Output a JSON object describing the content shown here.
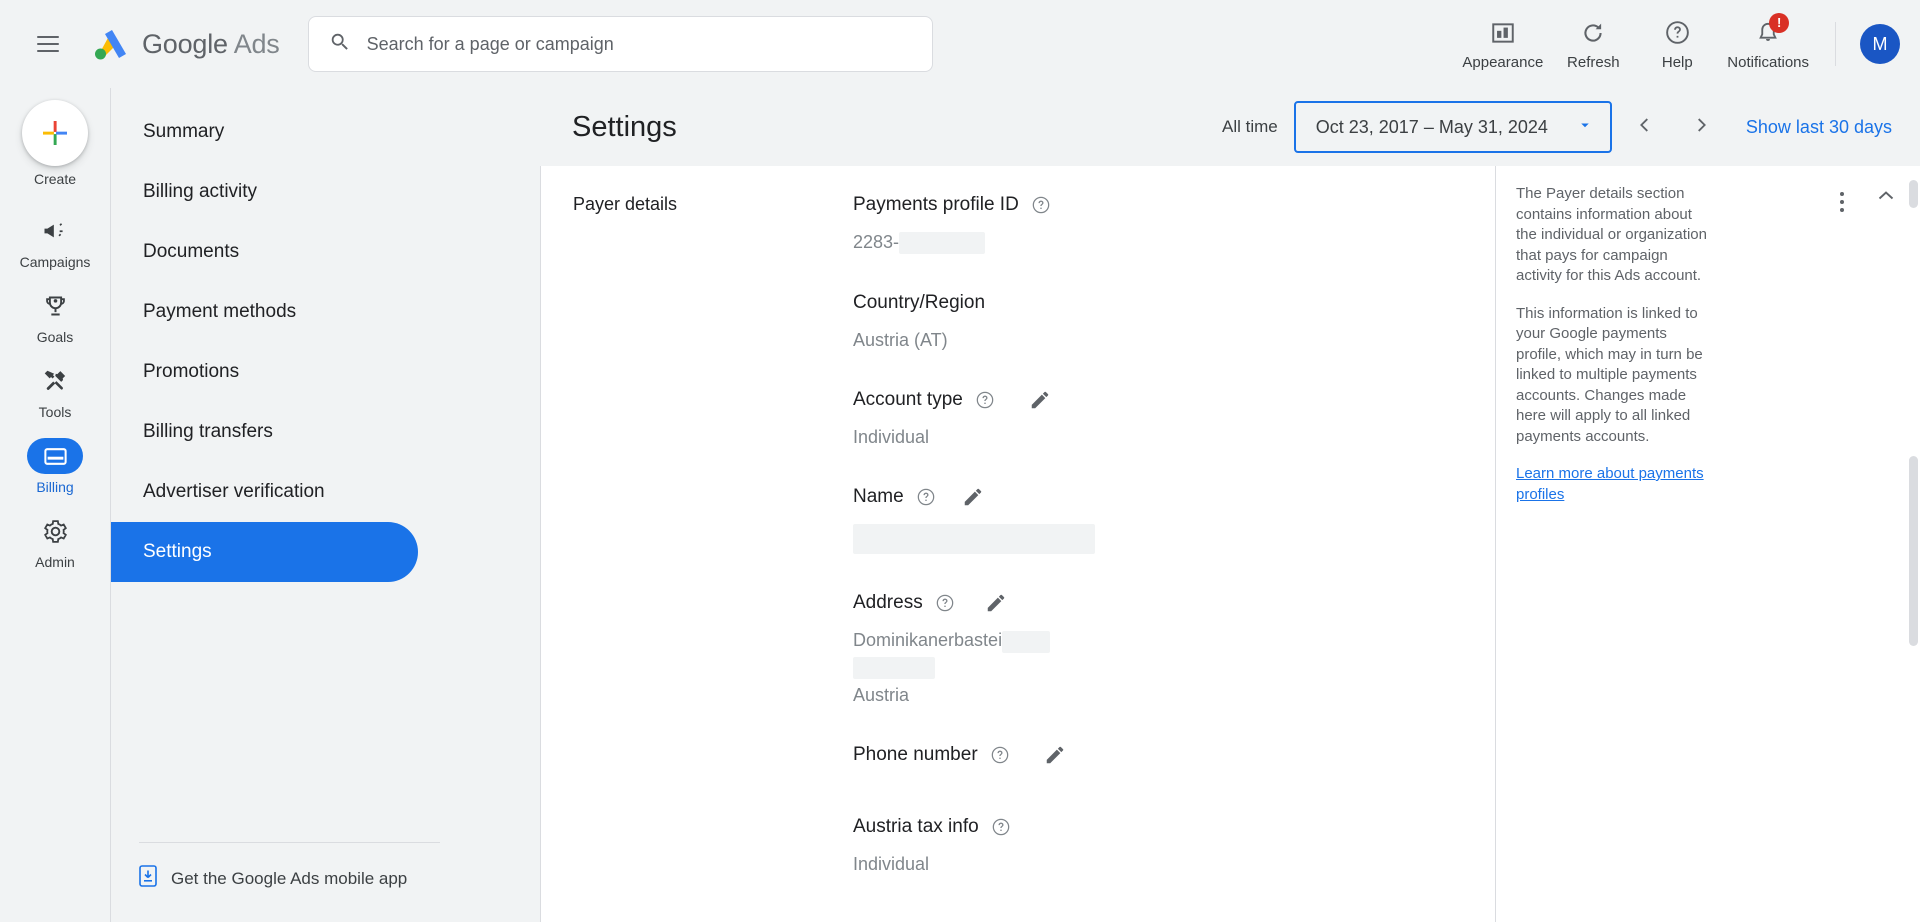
{
  "header": {
    "menu_icon": "hamburger-icon",
    "brand_google": "Google",
    "brand_ads": "Ads",
    "search": {
      "icon": "search-icon",
      "placeholder": "Search for a page or campaign",
      "value": ""
    },
    "tools": [
      {
        "icon": "appearance-icon",
        "label": "Appearance"
      },
      {
        "icon": "refresh-icon",
        "label": "Refresh"
      },
      {
        "icon": "help-icon",
        "label": "Help"
      },
      {
        "icon": "notifications-bell-icon",
        "label": "Notifications",
        "badge": "!"
      }
    ],
    "avatar_initial": "M"
  },
  "rail": {
    "items": [
      {
        "icon": "create-plus-icon",
        "label": "Create",
        "active": false
      },
      {
        "icon": "campaigns-megaphone-icon",
        "label": "Campaigns",
        "active": false
      },
      {
        "icon": "goals-trophy-icon",
        "label": "Goals",
        "active": false
      },
      {
        "icon": "tools-wrench-icon",
        "label": "Tools",
        "active": false
      },
      {
        "icon": "billing-card-icon",
        "label": "Billing",
        "active": true
      },
      {
        "icon": "admin-gear-icon",
        "label": "Admin",
        "active": false
      }
    ]
  },
  "subnav": {
    "items": [
      {
        "label": "Summary",
        "active": false
      },
      {
        "label": "Billing activity",
        "active": false
      },
      {
        "label": "Documents",
        "active": false
      },
      {
        "label": "Payment methods",
        "active": false
      },
      {
        "label": "Promotions",
        "active": false
      },
      {
        "label": "Billing transfers",
        "active": false
      },
      {
        "label": "Advertiser verification",
        "active": false
      },
      {
        "label": "Settings",
        "active": true
      }
    ],
    "footer": {
      "icon": "mobile-app-icon",
      "label": "Get the Google Ads mobile app"
    }
  },
  "main": {
    "page_title": "Settings",
    "daterange": {
      "preset_label": "All time",
      "range_text": "Oct 23, 2017 – May 31, 2024",
      "dropdown_icon": "chevron-down-icon",
      "prev_icon": "chevron-left-icon",
      "next_icon": "chevron-right-icon",
      "show_last_label": "Show last 30 days"
    },
    "section_title": "Payer details",
    "fields": [
      {
        "label": "Payments profile ID",
        "help": true,
        "edit": false,
        "value_prefix": "2283-",
        "redacted_inline_width": 86,
        "value": ""
      },
      {
        "label": "Country/Region",
        "help": false,
        "edit": false,
        "value": "Austria (AT)"
      },
      {
        "label": "Account type",
        "help": true,
        "edit": true,
        "value": "Individual"
      },
      {
        "label": "Name",
        "help": true,
        "edit": true,
        "value": "",
        "redacted_block_width": 242,
        "redacted_block_height": 30
      },
      {
        "label": "Address",
        "help": true,
        "edit": true,
        "value": "Dominikanerbastei",
        "redacted_inline_width": 48,
        "redacted_line2_width": 82,
        "value_line3": "Austria"
      },
      {
        "label": "Phone number",
        "help": true,
        "edit": true,
        "value": ""
      },
      {
        "label": "Austria tax info",
        "help": true,
        "edit": false,
        "value": "Individual"
      }
    ],
    "info_panel": {
      "paragraph_1": "The Payer details section contains information about the individual or organization that pays for campaign activity for this Ads account.",
      "paragraph_2": "This information is linked to your Google payments profile, which may in turn be linked to multiple payments accounts. Changes made here will apply to all linked payments accounts.",
      "link_text": "Learn more about payments profiles",
      "kebab_icon": "more-options-icon",
      "collapse_icon": "chevron-up-icon"
    }
  },
  "colors": {
    "accent_blue": "#1a73e8",
    "link_blue": "#1a73e8",
    "badge_red": "#d93025",
    "surface_gray": "#f1f3f4",
    "text_primary": "#202124",
    "text_secondary": "#5f6368",
    "text_muted": "#80868b"
  }
}
